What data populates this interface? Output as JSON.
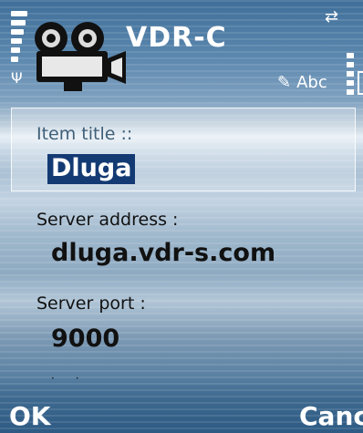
{
  "status_bar": {
    "signal_icon": "signal-strength-icon",
    "antenna_icon": "antenna-icon",
    "battery_icon": "battery-icon",
    "top_right_icon": "network-activity-icon"
  },
  "header": {
    "app_title": "VDR-C",
    "app_icon": "film-camera-icon",
    "input_mode_label": "Abc",
    "input_mode_icon": "pen-icon"
  },
  "form": {
    "fields": [
      {
        "label": "Item title ::",
        "value": "Dluga"
      },
      {
        "label": "Server address :",
        "value": "dluga.vdr-s.com"
      },
      {
        "label": "Server port :",
        "value": "9000"
      }
    ]
  },
  "softkeys": {
    "left": "OK",
    "right": "Cance"
  },
  "colors": {
    "selection_bg": "#133a73",
    "text": "#111111",
    "softkey_text": "#ffffff"
  }
}
